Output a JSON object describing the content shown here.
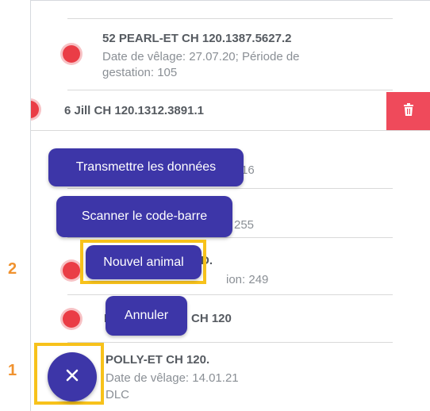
{
  "annotations": {
    "step1": "1",
    "step2": "2"
  },
  "list": {
    "items": [
      {
        "title": "52 PEARL-ET CH 120.1387.5627.2",
        "subtitle": "Date de vêlage: 27.07.20; Période de gestation: 105"
      },
      {
        "title": "6 Jill CH 120.1312.3891.1",
        "subtitle": ""
      },
      {
        "title": "",
        "subtitle": "16"
      },
      {
        "title": "",
        "subtitle": "255"
      },
      {
        "title": "D.",
        "subtitle": "ion: 249"
      },
      {
        "title": "P",
        "title_right": "CH 120",
        "subtitle": ""
      },
      {
        "title": "POLLY-ET CH 120.",
        "subtitle": "Date de vêlage: 14.01.21",
        "subtitle2": "DLC"
      }
    ]
  },
  "speed_dial": {
    "transmit_label": "Transmettre les données",
    "scan_label": "Scanner le code-barre",
    "new_animal_label": "Nouvel animal",
    "cancel_label": "Annuler"
  },
  "colors": {
    "accent": "#3d36a8",
    "status_red": "#ea3d46",
    "delete_red": "#ef4a5b",
    "highlight": "#f7c21b",
    "step_number": "#f0922f"
  },
  "icons": {
    "delete": "trash-icon",
    "fab": "close-icon"
  }
}
